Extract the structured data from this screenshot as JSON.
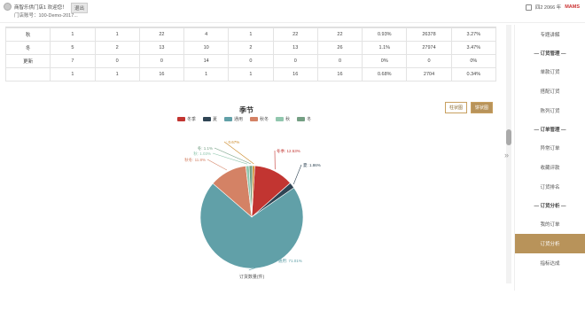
{
  "header": {
    "greeting": "商智乐供门店1 欢迎您！",
    "logout": "退出",
    "account": "门店账号：100-Demo-2017...",
    "right_text": "四2 2066 年",
    "brand": "MAMS"
  },
  "table": {
    "rows": [
      [
        "秋",
        "1",
        "1",
        "22",
        "4",
        "1",
        "22",
        "22",
        "0.93%",
        "26378",
        "3.27%"
      ],
      [
        "冬",
        "5",
        "2",
        "13",
        "10",
        "2",
        "13",
        "26",
        "1.1%",
        "27974",
        "3.47%"
      ],
      [
        "更新",
        "7",
        "0",
        "0",
        "14",
        "0",
        "0",
        "0",
        "0%",
        "0",
        "0%"
      ],
      [
        "",
        "1",
        "1",
        "16",
        "1",
        "1",
        "16",
        "16",
        "0.68%",
        "2704",
        "0.34%"
      ]
    ]
  },
  "chart_buttons": {
    "bar": "柱状图",
    "pie": "饼状图"
  },
  "chart_data": {
    "type": "pie",
    "title": "季节",
    "xlabel": "订货数量(件)",
    "series": [
      {
        "name": "冬季",
        "value": 12.53,
        "label": "冬季: 12.53%",
        "color": "#c23531"
      },
      {
        "name": "夏",
        "value": 1.86,
        "label": "夏: 1.86%",
        "color": "#2f4554"
      },
      {
        "name": "通用",
        "value": 71.01,
        "label": "通用: 71.01%",
        "color": "#61a0a8"
      },
      {
        "name": "秋冬",
        "value": 11.8,
        "label": "秋冬: 11.8%",
        "color": "#d48265"
      },
      {
        "name": "秋",
        "value": 1.03,
        "label": "秋: 1.03%",
        "color": "#91c7ae"
      },
      {
        "name": "冬",
        "value": 1.1,
        "label": "冬: 1.1%",
        "color": "#749f83"
      },
      {
        "name": "",
        "value": 0.67,
        "label": ": 0.67%",
        "color": "#ca8622"
      }
    ],
    "legend": [
      "冬季",
      "夏",
      "通用",
      "秋冬",
      "秋",
      "冬"
    ],
    "legend_position": "top"
  },
  "sidebar": {
    "items": [
      {
        "type": "item",
        "label": "专题讲解"
      },
      {
        "type": "group",
        "label": "— 订货管理 —"
      },
      {
        "type": "item",
        "label": "单款订货"
      },
      {
        "type": "item",
        "label": "搭配订货"
      },
      {
        "type": "item",
        "label": "陈列订货"
      },
      {
        "type": "group",
        "label": "— 订单管理 —"
      },
      {
        "type": "item",
        "label": "异常订单"
      },
      {
        "type": "item",
        "label": "收藏评款"
      },
      {
        "type": "item",
        "label": "订货排名"
      },
      {
        "type": "group",
        "label": "— 订货分析 —"
      },
      {
        "type": "item",
        "label": "我的订单"
      },
      {
        "type": "item",
        "label": "订货分析",
        "active": true
      },
      {
        "type": "item",
        "label": "指标达成"
      }
    ]
  }
}
